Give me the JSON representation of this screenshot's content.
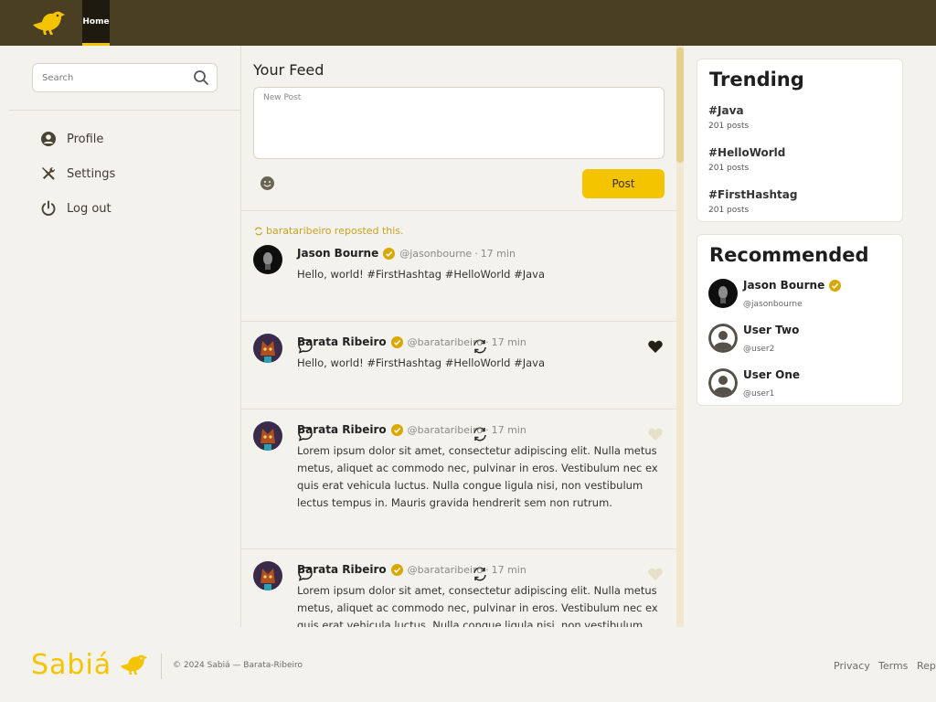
{
  "header": {
    "home_tab": "Home",
    "logo_icon": "bird-icon"
  },
  "sidebar": {
    "search_placeholder": "Search",
    "items": [
      {
        "label": "Profile",
        "icon": "profile-icon"
      },
      {
        "label": "Settings",
        "icon": "settings-icon"
      },
      {
        "label": "Log out",
        "icon": "power-icon"
      }
    ]
  },
  "feed": {
    "title": "Your Feed",
    "new_post_placeholder": "New Post",
    "post_button": "Post",
    "posts": [
      {
        "repost_note": "barataribeiro reposted this.",
        "author": "Jason Bourne",
        "handle": "@jasonbourne",
        "dot": "·",
        "time": "17 min",
        "body": "Hello, world! #FirstHashtag #HelloWorld #Java",
        "liked": true
      },
      {
        "author": "Barata Ribeiro",
        "handle": "@barataribeiro",
        "dot": "·",
        "time": "17 min",
        "body": "Hello, world! #FirstHashtag #HelloWorld #Java",
        "liked": false
      },
      {
        "author": "Barata Ribeiro",
        "handle": "@barataribeiro",
        "dot": "·",
        "time": "17 min",
        "body": "Lorem ipsum dolor sit amet, consectetur adipiscing elit. Nulla metus metus, aliquet ac commodo nec, pulvinar in eros. Vestibulum nec ex quis erat vehicula luctus. Nulla congue ligula nisi, non vestibulum lectus tempus in. Mauris gravida hendrerit sem non rutrum.",
        "liked": false
      },
      {
        "author": "Barata Ribeiro",
        "handle": "@barataribeiro",
        "dot": "·",
        "time": "17 min",
        "body": "Lorem ipsum dolor sit amet, consectetur adipiscing elit. Nulla metus metus, aliquet ac commodo nec, pulvinar in eros. Vestibulum nec ex quis erat vehicula luctus. Nulla congue ligula nisi, non vestibulum lectus tempus in. Mauris gravida hendrerit sem non rutrum.",
        "liked": false
      }
    ]
  },
  "trending": {
    "title": "Trending",
    "tags": [
      {
        "tag": "#Java",
        "count": "201 posts"
      },
      {
        "tag": "#HelloWorld",
        "count": "201 posts"
      },
      {
        "tag": "#FirstHashtag",
        "count": "201 posts"
      }
    ]
  },
  "recommended": {
    "title": "Recommended",
    "users": [
      {
        "name": "Jason Bourne",
        "handle": "@jasonbourne",
        "verified": true
      },
      {
        "name": "User Two",
        "handle": "@user2",
        "verified": false
      },
      {
        "name": "User One",
        "handle": "@user1",
        "verified": false
      }
    ]
  },
  "footer": {
    "brand": "Sabiá",
    "copyright": "© 2024 Sabiá — Barata-Ribeiro",
    "links": [
      "Privacy",
      "Terms",
      "Rep"
    ]
  },
  "colors": {
    "topbar": "#4a3f22",
    "accent": "#f5c400",
    "verified": "#d9a800",
    "repost": "#c9a227"
  }
}
